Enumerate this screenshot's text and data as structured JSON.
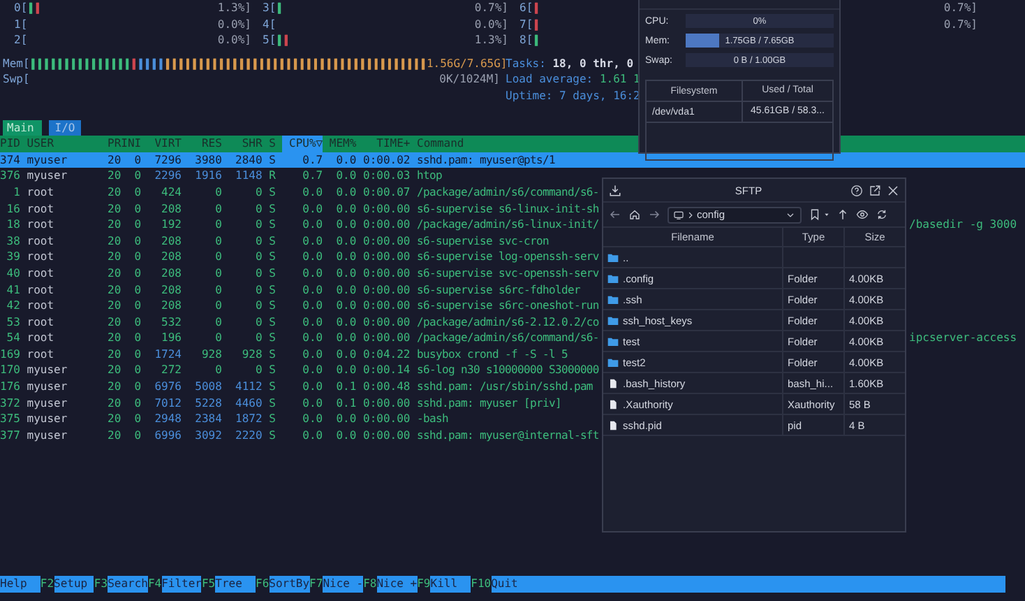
{
  "cpu_meters": [
    {
      "label": "0[",
      "bars": [
        {
          "text": "|",
          "color": "#3dbd7d"
        },
        {
          "text": "|",
          "color": "#d0464f"
        }
      ],
      "value": "1.3%]"
    },
    {
      "label": "3[",
      "bars": [
        {
          "text": "|",
          "color": "#3dbd7d"
        }
      ],
      "value": "0.7%]"
    },
    {
      "label": "6[",
      "bars": [
        {
          "text": "|",
          "color": "#d0464f"
        }
      ],
      "value": "0.7%]"
    },
    {
      "label": "1[",
      "value": "0.0%]"
    },
    {
      "label": "4[",
      "value": "0.0%]"
    },
    {
      "label": "7[",
      "bars": [
        {
          "text": "|",
          "color": "#d0464f"
        }
      ],
      "value": "0.7%]"
    },
    {
      "label": "2[",
      "value": "0.0%]"
    },
    {
      "label": "5[",
      "bars": [
        {
          "text": "|",
          "color": "#3dbd7d"
        },
        {
          "text": "|",
          "color": "#d0464f"
        }
      ],
      "value": "1.3%]"
    },
    {
      "label": "8[",
      "bars": [
        {
          "text": "|",
          "color": "#3dbd7d"
        }
      ]
    }
  ],
  "memory_meters": [
    {
      "label": "Mem[",
      "bars": [
        {
          "text": "|||||||||||||||",
          "color": "#3dbd7d"
        },
        {
          "text": "|",
          "color": "#d0464f"
        },
        {
          "text": "||||",
          "color": "#4b8fdc"
        },
        {
          "text": "|||||||||||||||||||||||||||||||||||||||",
          "color": "#d99a4e"
        }
      ],
      "value": "1.56G/7.65G]"
    },
    {
      "label": "Swp[",
      "value": "0K/1024M]"
    }
  ],
  "stats": [
    {
      "kind": "tasks",
      "label": "Tasks:",
      "value": "18, 0 thr, 0"
    },
    {
      "kind": "load",
      "label": "Load average:",
      "value": "1.61 1"
    },
    {
      "kind": "uptime",
      "label": "Uptime:",
      "value": "7 days, 16:2"
    }
  ],
  "tabs": [
    {
      "label": "Main",
      "selected": true
    },
    {
      "label": "I/O",
      "selected": false
    }
  ],
  "columns": [
    {
      "label": "PID",
      "selected": false
    },
    {
      "label": "USER",
      "selected": false
    },
    {
      "label": "PRI",
      "selected": false
    },
    {
      "label": "NI",
      "selected": false
    },
    {
      "label": "VIRT",
      "selected": false
    },
    {
      "label": "RES",
      "selected": false
    },
    {
      "label": "SHR",
      "selected": false
    },
    {
      "label": "S",
      "selected": false
    },
    {
      "label": "CPU%▽",
      "selected": true
    },
    {
      "label": "MEM%",
      "selected": false
    },
    {
      "label": "TIME+",
      "selected": false
    },
    {
      "label": "Command",
      "selected": false
    }
  ],
  "processes": [
    {
      "pid": "374",
      "user": "myuser",
      "pri": "20",
      "ni": "0",
      "virt": "7296",
      "res": "3980",
      "shr": "2840",
      "state": "S",
      "cpu": "0.7",
      "mem": "0.0",
      "time": "0:00.02",
      "command": "sshd.pam: myuser@pts/1",
      "selected": true
    },
    {
      "pid": "376",
      "user": "myuser",
      "pri": "20",
      "ni": "0",
      "virt": "2296",
      "res": "1916",
      "shr": "1148",
      "state": "R",
      "cpu": "0.7",
      "mem": "0.0",
      "time": "0:00.03",
      "command": "htop",
      "selected": false
    },
    {
      "pid": "1",
      "user": "root",
      "pri": "20",
      "ni": "0",
      "virt": "424",
      "res": "0",
      "shr": "0",
      "state": "S",
      "cpu": "0.0",
      "mem": "0.0",
      "time": "0:00.07",
      "command": "/package/admin/s6/command/s6-",
      "selected": false
    },
    {
      "pid": "16",
      "user": "root",
      "pri": "20",
      "ni": "0",
      "virt": "208",
      "res": "0",
      "shr": "0",
      "state": "S",
      "cpu": "0.0",
      "mem": "0.0",
      "time": "0:00.00",
      "command": "s6-supervise s6-linux-init-sh",
      "selected": false
    },
    {
      "pid": "18",
      "user": "root",
      "pri": "20",
      "ni": "0",
      "virt": "192",
      "res": "0",
      "shr": "0",
      "state": "S",
      "cpu": "0.0",
      "mem": "0.0",
      "time": "0:00.00",
      "command": "/package/admin/s6-linux-init/",
      "command_tail": "/basedir -g 3000",
      "selected": false
    },
    {
      "pid": "38",
      "user": "root",
      "pri": "20",
      "ni": "0",
      "virt": "208",
      "res": "0",
      "shr": "0",
      "state": "S",
      "cpu": "0.0",
      "mem": "0.0",
      "time": "0:00.00",
      "command": "s6-supervise svc-cron",
      "selected": false
    },
    {
      "pid": "39",
      "user": "root",
      "pri": "20",
      "ni": "0",
      "virt": "208",
      "res": "0",
      "shr": "0",
      "state": "S",
      "cpu": "0.0",
      "mem": "0.0",
      "time": "0:00.00",
      "command": "s6-supervise log-openssh-serv",
      "selected": false
    },
    {
      "pid": "40",
      "user": "root",
      "pri": "20",
      "ni": "0",
      "virt": "208",
      "res": "0",
      "shr": "0",
      "state": "S",
      "cpu": "0.0",
      "mem": "0.0",
      "time": "0:00.00",
      "command": "s6-supervise svc-openssh-serv",
      "selected": false
    },
    {
      "pid": "41",
      "user": "root",
      "pri": "20",
      "ni": "0",
      "virt": "208",
      "res": "0",
      "shr": "0",
      "state": "S",
      "cpu": "0.0",
      "mem": "0.0",
      "time": "0:00.00",
      "command": "s6-supervise s6rc-fdholder",
      "selected": false
    },
    {
      "pid": "42",
      "user": "root",
      "pri": "20",
      "ni": "0",
      "virt": "208",
      "res": "0",
      "shr": "0",
      "state": "S",
      "cpu": "0.0",
      "mem": "0.0",
      "time": "0:00.00",
      "command": "s6-supervise s6rc-oneshot-run",
      "selected": false
    },
    {
      "pid": "53",
      "user": "root",
      "pri": "20",
      "ni": "0",
      "virt": "532",
      "res": "0",
      "shr": "0",
      "state": "S",
      "cpu": "0.0",
      "mem": "0.0",
      "time": "0:00.00",
      "command": "/package/admin/s6-2.12.0.2/co",
      "selected": false
    },
    {
      "pid": "54",
      "user": "root",
      "pri": "20",
      "ni": "0",
      "virt": "196",
      "res": "0",
      "shr": "0",
      "state": "S",
      "cpu": "0.0",
      "mem": "0.0",
      "time": "0:00.00",
      "command": "/package/admin/s6/command/s6-",
      "command_tail": "ipcserver-access",
      "selected": false
    },
    {
      "pid": "169",
      "user": "root",
      "pri": "20",
      "ni": "0",
      "virt": "1724",
      "res": "928",
      "shr": "928",
      "state": "S",
      "cpu": "0.0",
      "mem": "0.0",
      "time": "0:04.22",
      "command": "busybox crond -f -S -l 5",
      "selected": false
    },
    {
      "pid": "170",
      "user": "myuser",
      "pri": "20",
      "ni": "0",
      "virt": "272",
      "res": "0",
      "shr": "0",
      "state": "S",
      "cpu": "0.0",
      "mem": "0.0",
      "time": "0:00.14",
      "command": "s6-log n30 s10000000 S3000000",
      "selected": false
    },
    {
      "pid": "176",
      "user": "myuser",
      "pri": "20",
      "ni": "0",
      "virt": "6976",
      "res": "5008",
      "shr": "4112",
      "state": "S",
      "cpu": "0.0",
      "mem": "0.1",
      "time": "0:00.48",
      "command": "sshd.pam: /usr/sbin/sshd.pam",
      "selected": false
    },
    {
      "pid": "372",
      "user": "myuser",
      "pri": "20",
      "ni": "0",
      "virt": "7012",
      "res": "5228",
      "shr": "4460",
      "state": "S",
      "cpu": "0.0",
      "mem": "0.1",
      "time": "0:00.00",
      "command": "sshd.pam: myuser [priv]",
      "selected": false
    },
    {
      "pid": "375",
      "user": "myuser",
      "pri": "20",
      "ni": "0",
      "virt": "2948",
      "res": "2384",
      "shr": "1872",
      "state": "S",
      "cpu": "0.0",
      "mem": "0.0",
      "time": "0:00.00",
      "command": "-bash",
      "selected": false
    },
    {
      "pid": "377",
      "user": "myuser",
      "pri": "20",
      "ni": "0",
      "virt": "6996",
      "res": "3092",
      "shr": "2220",
      "state": "S",
      "cpu": "0.0",
      "mem": "0.0",
      "time": "0:00.00",
      "command": "sshd.pam: myuser@internal-sft",
      "selected": false
    }
  ],
  "function_keys": [
    {
      "label": "Help"
    },
    {
      "key": "F2",
      "label": "Setup"
    },
    {
      "key": "F3",
      "label": "Search"
    },
    {
      "key": "F4",
      "label": "Filter"
    },
    {
      "key": "F5",
      "label": "Tree"
    },
    {
      "key": "F6",
      "label": "SortBy"
    },
    {
      "key": "F7",
      "label": "Nice -"
    },
    {
      "key": "F8",
      "label": "Nice +"
    },
    {
      "key": "F9",
      "label": "Kill"
    },
    {
      "key": "F10",
      "label": "Quit"
    }
  ],
  "system_info": {
    "meters": [
      {
        "label": "CPU:",
        "value": "0%"
      },
      {
        "label": "Mem:",
        "level": 0.23,
        "value": "1.75GB / 7.65GB"
      },
      {
        "label": "Swap:",
        "value": "0 B / 1.00GB"
      }
    ],
    "filesystem": {
      "columns": [
        "Filesystem",
        "Used / Total"
      ],
      "rows": [
        [
          "/dev/vda1",
          "45.61GB / 58.3..."
        ]
      ]
    }
  },
  "sftp": {
    "title": "SFTP",
    "path": "config",
    "columns": [
      "Filename",
      "Type",
      "Size"
    ],
    "files": [
      {
        "kind": "folder",
        "name": ".."
      },
      {
        "kind": "folder",
        "name": ".config",
        "type": "Folder",
        "size": "4.00KB"
      },
      {
        "kind": "folder",
        "name": ".ssh",
        "type": "Folder",
        "size": "4.00KB"
      },
      {
        "kind": "folder",
        "name": "ssh_host_keys",
        "type": "Folder",
        "size": "4.00KB"
      },
      {
        "kind": "folder",
        "name": "test",
        "type": "Folder",
        "size": "4.00KB"
      },
      {
        "kind": "folder",
        "name": "test2",
        "type": "Folder",
        "size": "4.00KB"
      },
      {
        "kind": "file",
        "name": ".bash_history",
        "type": "bash_hi...",
        "size": "1.60KB"
      },
      {
        "kind": "file",
        "name": ".Xauthority",
        "type": "Xauthority",
        "size": "58 B"
      },
      {
        "kind": "file",
        "name": "sshd.pid",
        "type": "pid",
        "size": "4 B"
      }
    ]
  }
}
